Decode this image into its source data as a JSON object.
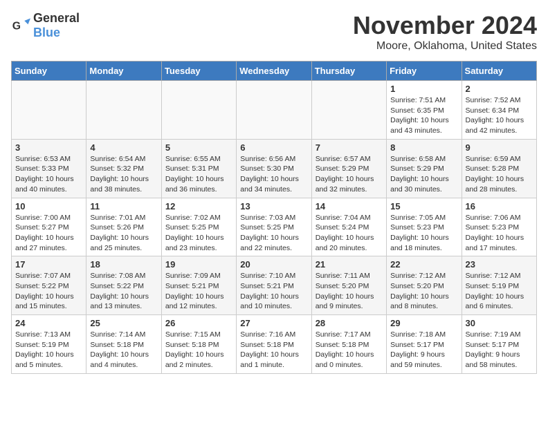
{
  "header": {
    "logo_general": "General",
    "logo_blue": "Blue",
    "month": "November 2024",
    "location": "Moore, Oklahoma, United States"
  },
  "weekdays": [
    "Sunday",
    "Monday",
    "Tuesday",
    "Wednesday",
    "Thursday",
    "Friday",
    "Saturday"
  ],
  "weeks": [
    [
      {
        "day": "",
        "info": ""
      },
      {
        "day": "",
        "info": ""
      },
      {
        "day": "",
        "info": ""
      },
      {
        "day": "",
        "info": ""
      },
      {
        "day": "",
        "info": ""
      },
      {
        "day": "1",
        "info": "Sunrise: 7:51 AM\nSunset: 6:35 PM\nDaylight: 10 hours and 43 minutes."
      },
      {
        "day": "2",
        "info": "Sunrise: 7:52 AM\nSunset: 6:34 PM\nDaylight: 10 hours and 42 minutes."
      }
    ],
    [
      {
        "day": "3",
        "info": "Sunrise: 6:53 AM\nSunset: 5:33 PM\nDaylight: 10 hours and 40 minutes."
      },
      {
        "day": "4",
        "info": "Sunrise: 6:54 AM\nSunset: 5:32 PM\nDaylight: 10 hours and 38 minutes."
      },
      {
        "day": "5",
        "info": "Sunrise: 6:55 AM\nSunset: 5:31 PM\nDaylight: 10 hours and 36 minutes."
      },
      {
        "day": "6",
        "info": "Sunrise: 6:56 AM\nSunset: 5:30 PM\nDaylight: 10 hours and 34 minutes."
      },
      {
        "day": "7",
        "info": "Sunrise: 6:57 AM\nSunset: 5:29 PM\nDaylight: 10 hours and 32 minutes."
      },
      {
        "day": "8",
        "info": "Sunrise: 6:58 AM\nSunset: 5:29 PM\nDaylight: 10 hours and 30 minutes."
      },
      {
        "day": "9",
        "info": "Sunrise: 6:59 AM\nSunset: 5:28 PM\nDaylight: 10 hours and 28 minutes."
      }
    ],
    [
      {
        "day": "10",
        "info": "Sunrise: 7:00 AM\nSunset: 5:27 PM\nDaylight: 10 hours and 27 minutes."
      },
      {
        "day": "11",
        "info": "Sunrise: 7:01 AM\nSunset: 5:26 PM\nDaylight: 10 hours and 25 minutes."
      },
      {
        "day": "12",
        "info": "Sunrise: 7:02 AM\nSunset: 5:25 PM\nDaylight: 10 hours and 23 minutes."
      },
      {
        "day": "13",
        "info": "Sunrise: 7:03 AM\nSunset: 5:25 PM\nDaylight: 10 hours and 22 minutes."
      },
      {
        "day": "14",
        "info": "Sunrise: 7:04 AM\nSunset: 5:24 PM\nDaylight: 10 hours and 20 minutes."
      },
      {
        "day": "15",
        "info": "Sunrise: 7:05 AM\nSunset: 5:23 PM\nDaylight: 10 hours and 18 minutes."
      },
      {
        "day": "16",
        "info": "Sunrise: 7:06 AM\nSunset: 5:23 PM\nDaylight: 10 hours and 17 minutes."
      }
    ],
    [
      {
        "day": "17",
        "info": "Sunrise: 7:07 AM\nSunset: 5:22 PM\nDaylight: 10 hours and 15 minutes."
      },
      {
        "day": "18",
        "info": "Sunrise: 7:08 AM\nSunset: 5:22 PM\nDaylight: 10 hours and 13 minutes."
      },
      {
        "day": "19",
        "info": "Sunrise: 7:09 AM\nSunset: 5:21 PM\nDaylight: 10 hours and 12 minutes."
      },
      {
        "day": "20",
        "info": "Sunrise: 7:10 AM\nSunset: 5:21 PM\nDaylight: 10 hours and 10 minutes."
      },
      {
        "day": "21",
        "info": "Sunrise: 7:11 AM\nSunset: 5:20 PM\nDaylight: 10 hours and 9 minutes."
      },
      {
        "day": "22",
        "info": "Sunrise: 7:12 AM\nSunset: 5:20 PM\nDaylight: 10 hours and 8 minutes."
      },
      {
        "day": "23",
        "info": "Sunrise: 7:12 AM\nSunset: 5:19 PM\nDaylight: 10 hours and 6 minutes."
      }
    ],
    [
      {
        "day": "24",
        "info": "Sunrise: 7:13 AM\nSunset: 5:19 PM\nDaylight: 10 hours and 5 minutes."
      },
      {
        "day": "25",
        "info": "Sunrise: 7:14 AM\nSunset: 5:18 PM\nDaylight: 10 hours and 4 minutes."
      },
      {
        "day": "26",
        "info": "Sunrise: 7:15 AM\nSunset: 5:18 PM\nDaylight: 10 hours and 2 minutes."
      },
      {
        "day": "27",
        "info": "Sunrise: 7:16 AM\nSunset: 5:18 PM\nDaylight: 10 hours and 1 minute."
      },
      {
        "day": "28",
        "info": "Sunrise: 7:17 AM\nSunset: 5:18 PM\nDaylight: 10 hours and 0 minutes."
      },
      {
        "day": "29",
        "info": "Sunrise: 7:18 AM\nSunset: 5:17 PM\nDaylight: 9 hours and 59 minutes."
      },
      {
        "day": "30",
        "info": "Sunrise: 7:19 AM\nSunset: 5:17 PM\nDaylight: 9 hours and 58 minutes."
      }
    ]
  ]
}
